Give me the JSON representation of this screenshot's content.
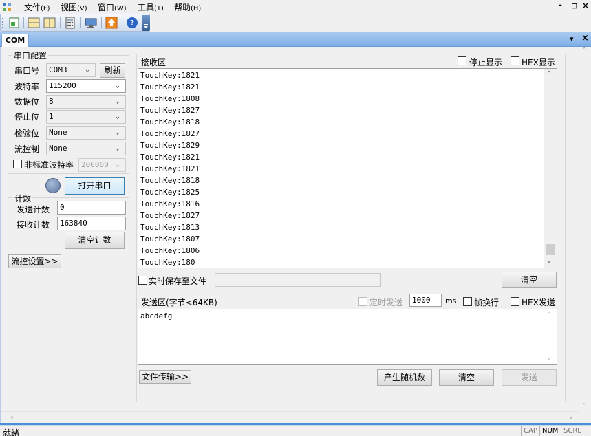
{
  "menu": {
    "items": [
      {
        "label": "文件",
        "key": "(F)"
      },
      {
        "label": "视图",
        "key": "(V)"
      },
      {
        "label": "窗口",
        "key": "(W)"
      },
      {
        "label": "工具",
        "key": "(T)"
      },
      {
        "label": "帮助",
        "key": "(H)"
      }
    ],
    "window_controls": [
      "-",
      "⊡",
      "×"
    ]
  },
  "toolbar": {
    "icons": [
      "new-icon",
      "split-horizontal-icon",
      "split-vertical-icon",
      "calculator-icon",
      "monitor-icon",
      "upload-icon",
      "help-icon"
    ]
  },
  "tab": {
    "label": "COM",
    "controls": [
      "▾",
      "×"
    ]
  },
  "serial_config": {
    "title": "串口配置",
    "port_label": "串口号",
    "port_value": "COM3",
    "refresh_label": "刷新",
    "baud_label": "波特率",
    "baud_value": "115200",
    "databits_label": "数据位",
    "databits_value": "8",
    "stopbits_label": "停止位",
    "stopbits_value": "1",
    "parity_label": "检验位",
    "parity_value": "None",
    "flow_label": "流控制",
    "flow_value": "None",
    "nonstd_label": "非标准波特率",
    "nonstd_value": "200000",
    "open_label": "打开串口"
  },
  "counter": {
    "title": "计数",
    "send_label": "发送计数",
    "send_value": "0",
    "recv_label": "接收计数",
    "recv_value": "163840",
    "clear_label": "清空计数"
  },
  "flow_settings_label": "流控设置>>",
  "receive": {
    "title": "接收区",
    "stop_display_label": "停止显示",
    "hex_display_label": "HEX显示",
    "lines": [
      "TouchKey:1821",
      "TouchKey:1821",
      "TouchKey:1808",
      "TouchKey:1827",
      "TouchKey:1818",
      "TouchKey:1827",
      "TouchKey:1829",
      "TouchKey:1821",
      "TouchKey:1821",
      "TouchKey:1818",
      "TouchKey:1825",
      "TouchKey:1816",
      "TouchKey:1827",
      "TouchKey:1813",
      "TouchKey:1807",
      "TouchKey:1806",
      "TouchKey:180"
    ],
    "save_file_label": "实时保存至文件",
    "clear_label": "清空"
  },
  "send": {
    "title": "发送区(字节<64KB)",
    "timed_label": "定时发送",
    "interval_value": "1000",
    "interval_unit": "ms",
    "newline_label": "帧换行",
    "hex_send_label": "HEX发送",
    "content": "abcdefg",
    "file_transfer_label": "文件传输>>",
    "random_label": "产生随机数",
    "clear_label": "清空",
    "send_label": "发送"
  },
  "status": {
    "text": "就绪",
    "indicators": [
      "CAP",
      "NUM",
      "SCRL"
    ]
  }
}
